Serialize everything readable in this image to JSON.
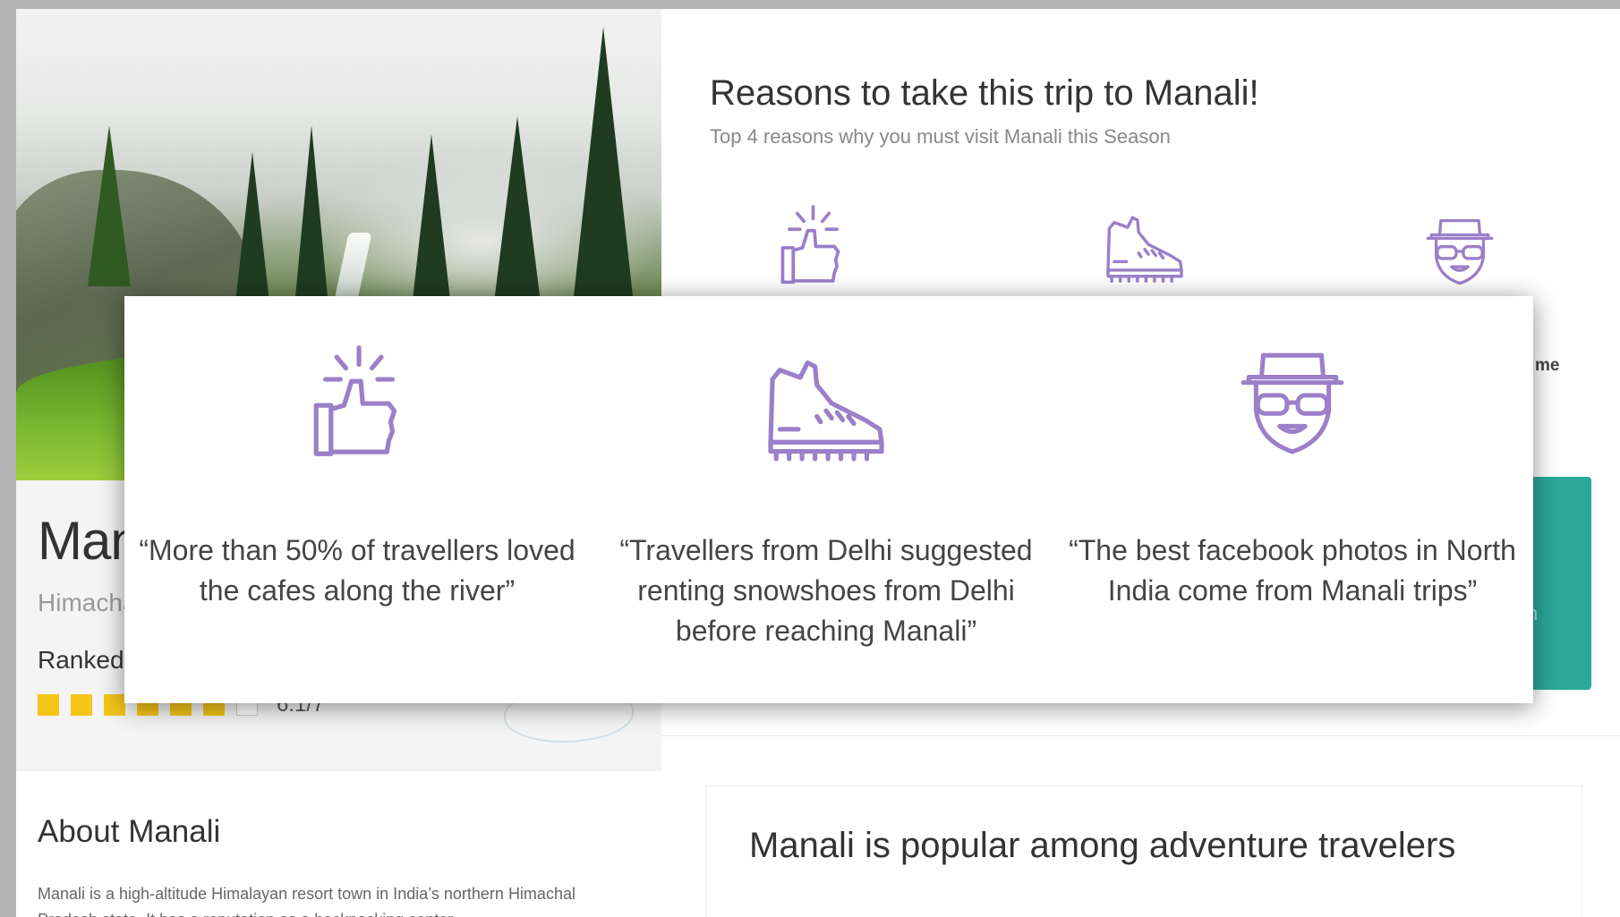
{
  "destination": {
    "name": "Manali",
    "state": "Himachal Pradesh",
    "ranked_label": "Ranked",
    "rating_text": "6.1/7",
    "rating_filled": 6,
    "rating_total": 7
  },
  "about": {
    "title": "About Manali",
    "text": "Manali is a high-altitude Himalayan resort town in India’s northern Himachal Pradesh state. It has a reputation as a backpacking center"
  },
  "reasons": {
    "title": "Reasons to take this trip to Manali!",
    "subtitle": "Top 4 reasons why you must visit Manali this Season",
    "peek_text": "me",
    "items": [
      {
        "icon": "thumbs-up-icon",
        "quote": "“More than 50% of travellers loved the cafes along the river”"
      },
      {
        "icon": "hiking-boot-icon",
        "quote": "“Travellers from Delhi suggested renting snowshoes from Delhi before reaching Manali”"
      },
      {
        "icon": "tourist-face-icon",
        "quote": "“The best facebook photos in North India come from Manali trips”"
      }
    ]
  },
  "teal_card": {
    "peek_text": "n"
  },
  "popular": {
    "title": "Manali is popular among adventure travelers"
  },
  "colors": {
    "icon_purple": "#9b7fc9",
    "star_yellow": "#f5c518",
    "teal": "#2aa99a"
  }
}
